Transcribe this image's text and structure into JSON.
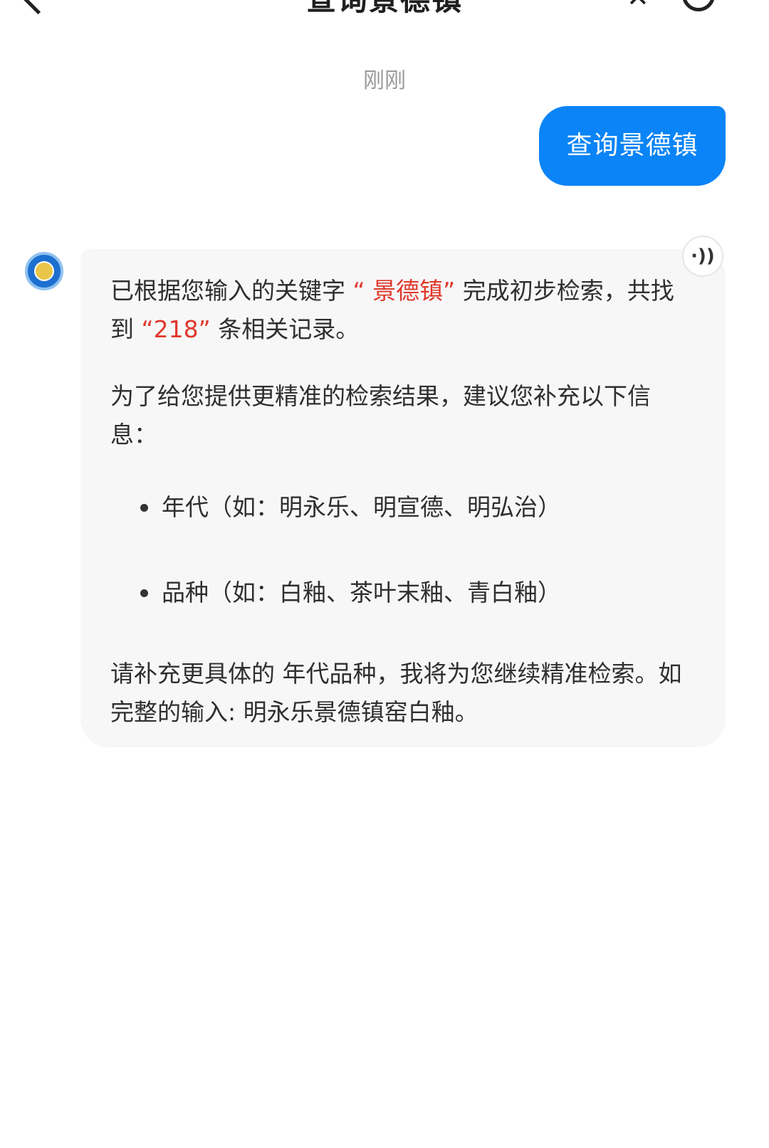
{
  "header": {
    "title": "查询景德镇",
    "back_icon": "chevron-left-icon",
    "close_icon": "close-icon",
    "history_icon": "history-icon"
  },
  "timestamp": "刚刚",
  "user_message": {
    "text": "查询景德镇",
    "bubble_color": "#0a84f6"
  },
  "bot_message": {
    "avatar_icon": "org-logo-icon",
    "speaker_icon": "speaker-icon",
    "speaker_glyph": "·))",
    "p1": {
      "prefix": "已根据您输入的关键字",
      "keyword": "“ 景德镇”",
      "middle": "完成初步检索，共找到",
      "count": "“218”",
      "suffix": "条相关记录。"
    },
    "p2": "为了给您提供更精准的检索结果，建议您补充以下信息：",
    "bullets": [
      "年代（如：明永乐、明宣德、明弘治）",
      "品种（如：白釉、茶叶末釉、青白釉）"
    ],
    "p3": "请补充更具体的 年代品种，我将为您继续精准检索。如完整的输入: 明永乐景德镇窑白釉。",
    "highlight_color": "#e0382b"
  }
}
